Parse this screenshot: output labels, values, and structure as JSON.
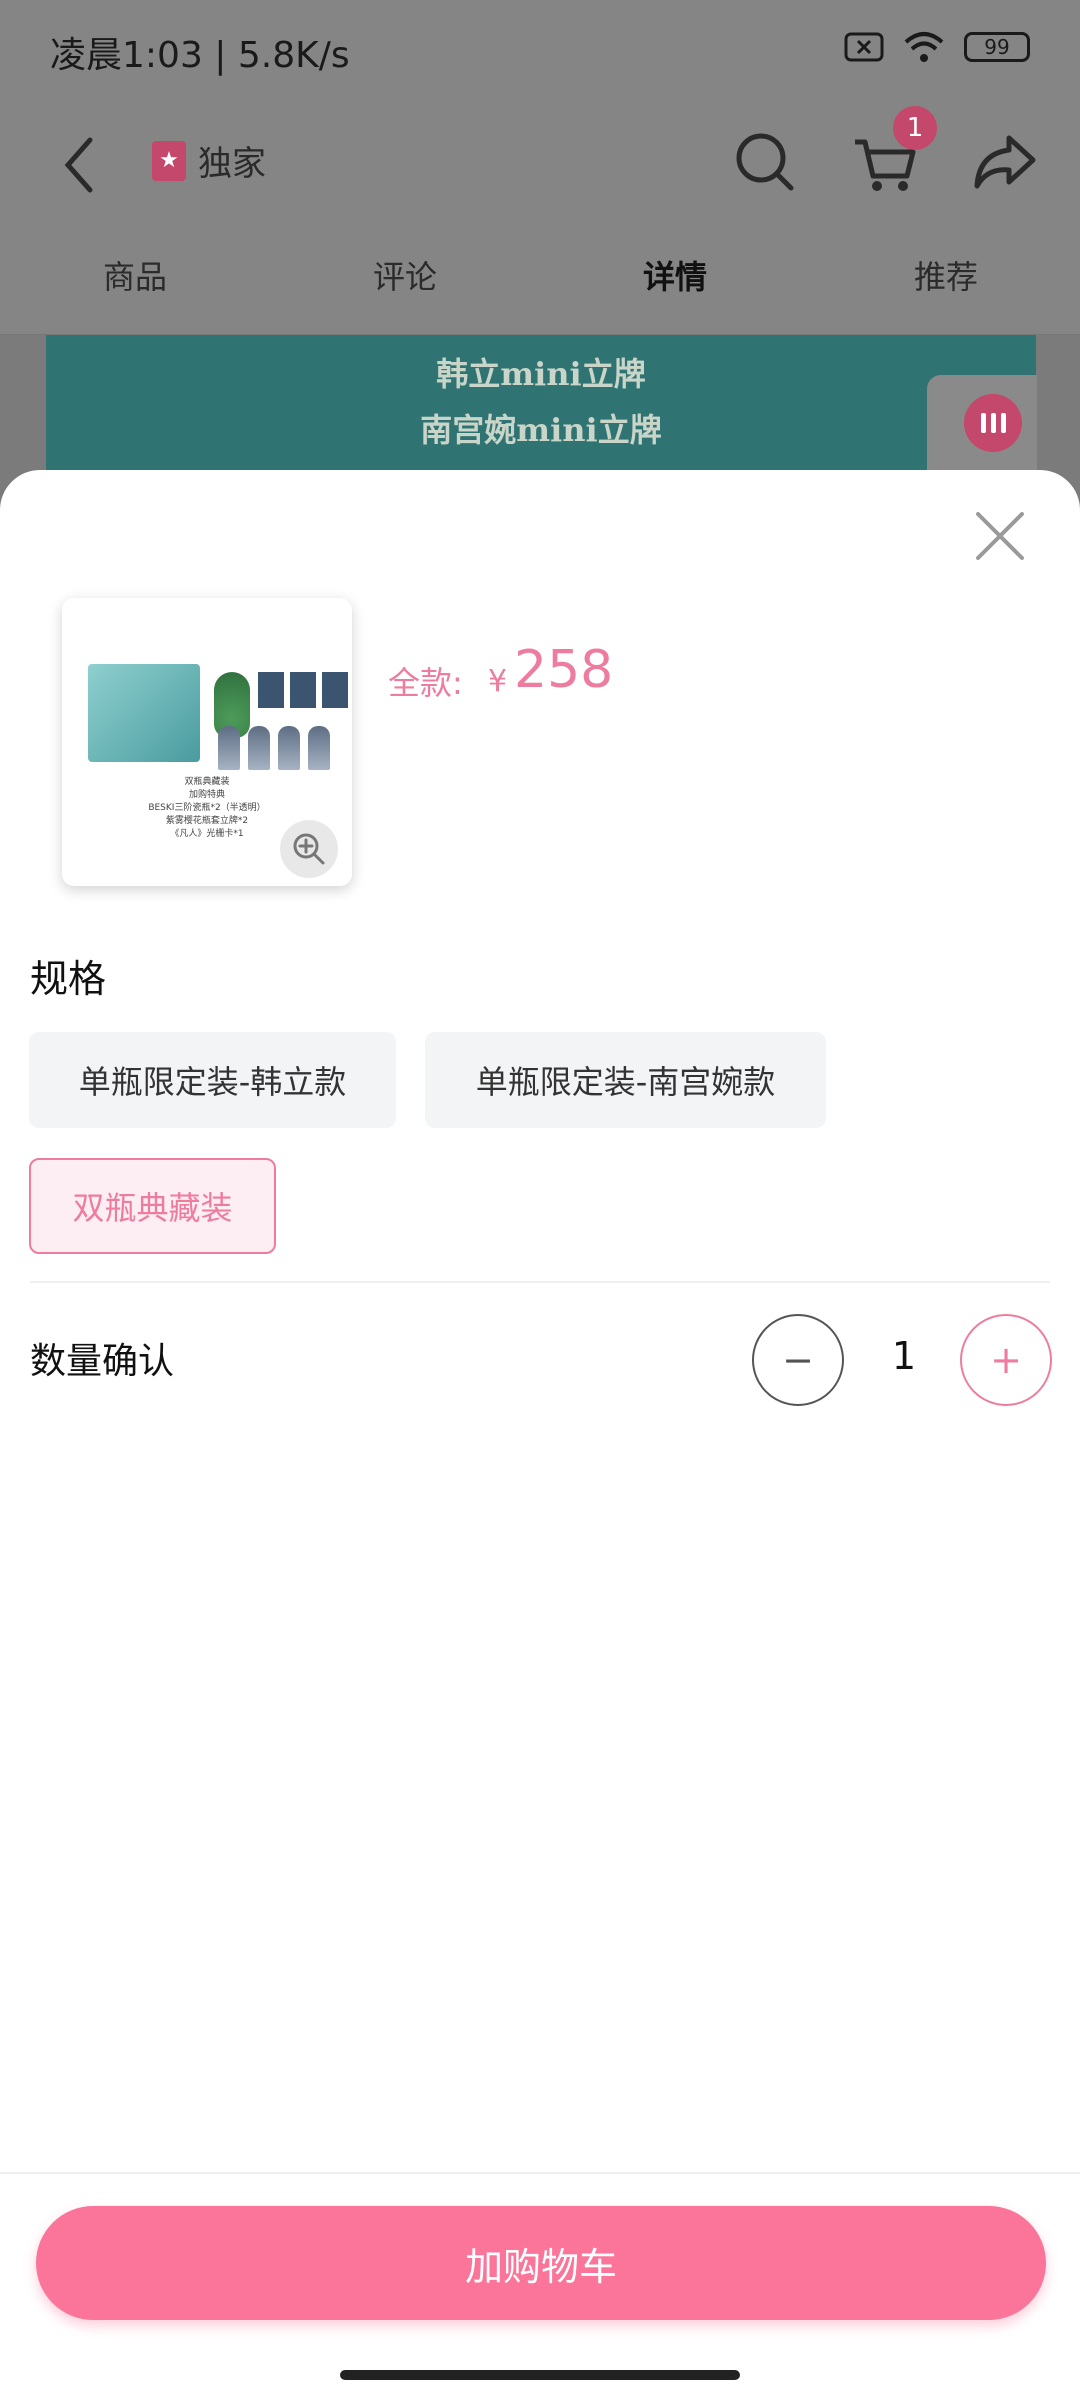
{
  "status_bar": {
    "time": "凌晨1:03 | 5.8K/s",
    "battery": "99"
  },
  "navbar": {
    "exclusive_label": "独家",
    "cart_badge": "1"
  },
  "tabs": [
    {
      "label": "商品"
    },
    {
      "label": "评论"
    },
    {
      "label": "详情"
    },
    {
      "label": "推荐"
    }
  ],
  "banner": {
    "line1": "韩立mini立牌",
    "line2": "南宫婉mini立牌"
  },
  "sheet": {
    "thumb_caption": [
      "双瓶典藏装",
      "加购特典",
      "BESKI三阶瓷瓶*2（半透明）",
      "紫雾樱花瓶套立牌*2",
      "《凡人》光栅卡*1"
    ],
    "price_label": "全款:",
    "price_currency": "¥",
    "price_value": "258",
    "spec_title": "规格",
    "options": [
      {
        "label": "单瓶限定装-韩立款",
        "selected": false
      },
      {
        "label": "单瓶限定装-南宫婉款",
        "selected": false
      },
      {
        "label": "双瓶典藏装",
        "selected": true
      }
    ],
    "quantity_title": "数量确认",
    "quantity_minus": "−",
    "quantity_value": "1",
    "quantity_plus": "+",
    "add_to_cart": "加购物车"
  },
  "colors": {
    "accent": "#ee7c9f",
    "cta": "#fb7499",
    "banner": "#2f7472"
  }
}
